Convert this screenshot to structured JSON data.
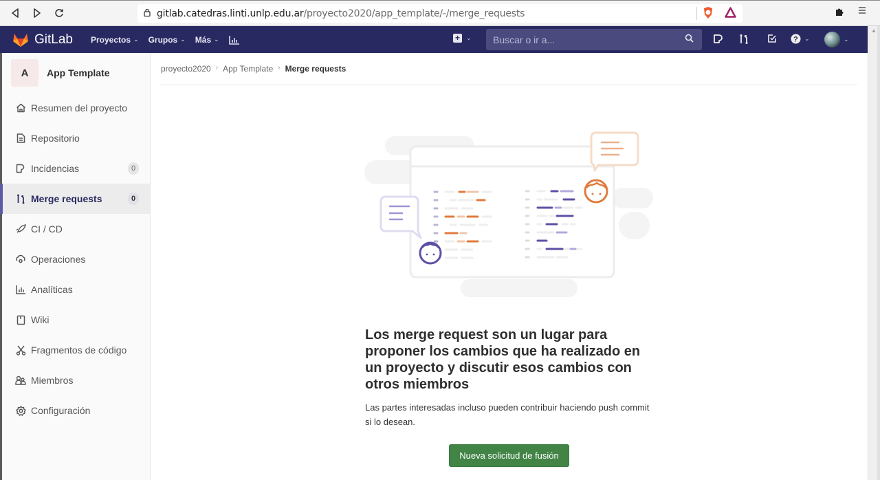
{
  "browser": {
    "url_host": "gitlab.catedras.linti.unlp.edu.ar",
    "url_path": "/proyecto2020/app_template/-/merge_requests",
    "icons": [
      "back-icon",
      "forward-icon",
      "reload-icon",
      "bookmark-icon",
      "lock-icon",
      "brave-shield-icon",
      "brave-rewards-icon",
      "extensions-icon",
      "menu-icon"
    ]
  },
  "header": {
    "brand": "GitLab",
    "nav": [
      {
        "label": "Proyectos"
      },
      {
        "label": "Grupos"
      },
      {
        "label": "Más"
      }
    ],
    "search_placeholder": "Buscar o ir a..."
  },
  "sidebar": {
    "project_initial": "A",
    "project_name": "App Template",
    "items": [
      {
        "label": "Resumen del proyecto",
        "icon": "home-icon"
      },
      {
        "label": "Repositorio",
        "icon": "repository-icon"
      },
      {
        "label": "Incidencias",
        "icon": "issues-icon",
        "badge": "0"
      },
      {
        "label": "Merge requests",
        "icon": "merge-request-icon",
        "badge": "0",
        "active": true
      },
      {
        "label": "CI / CD",
        "icon": "rocket-icon"
      },
      {
        "label": "Operaciones",
        "icon": "cloud-gear-icon"
      },
      {
        "label": "Analíticas",
        "icon": "chart-icon"
      },
      {
        "label": "Wiki",
        "icon": "book-icon"
      },
      {
        "label": "Fragmentos de código",
        "icon": "snippet-scissors-icon"
      },
      {
        "label": "Miembros",
        "icon": "users-icon"
      },
      {
        "label": "Configuración",
        "icon": "gear-icon"
      }
    ]
  },
  "breadcrumb": {
    "items": [
      "proyecto2020",
      "App Template"
    ],
    "current": "Merge requests"
  },
  "empty_state": {
    "title": "Los merge request son un lugar para proponer los cambios que ha realizado en un proyecto y discutir esos cambios con otros miembros",
    "description": "Las partes interesadas incluso pueden contribuir haciendo push commit si lo desean.",
    "button": "Nueva solicitud de fusión"
  },
  "colors": {
    "header_bg": "#292961",
    "primary_button": "#428446",
    "illustration_orange": "#e07b3c",
    "illustration_purple": "#5e50a6"
  }
}
